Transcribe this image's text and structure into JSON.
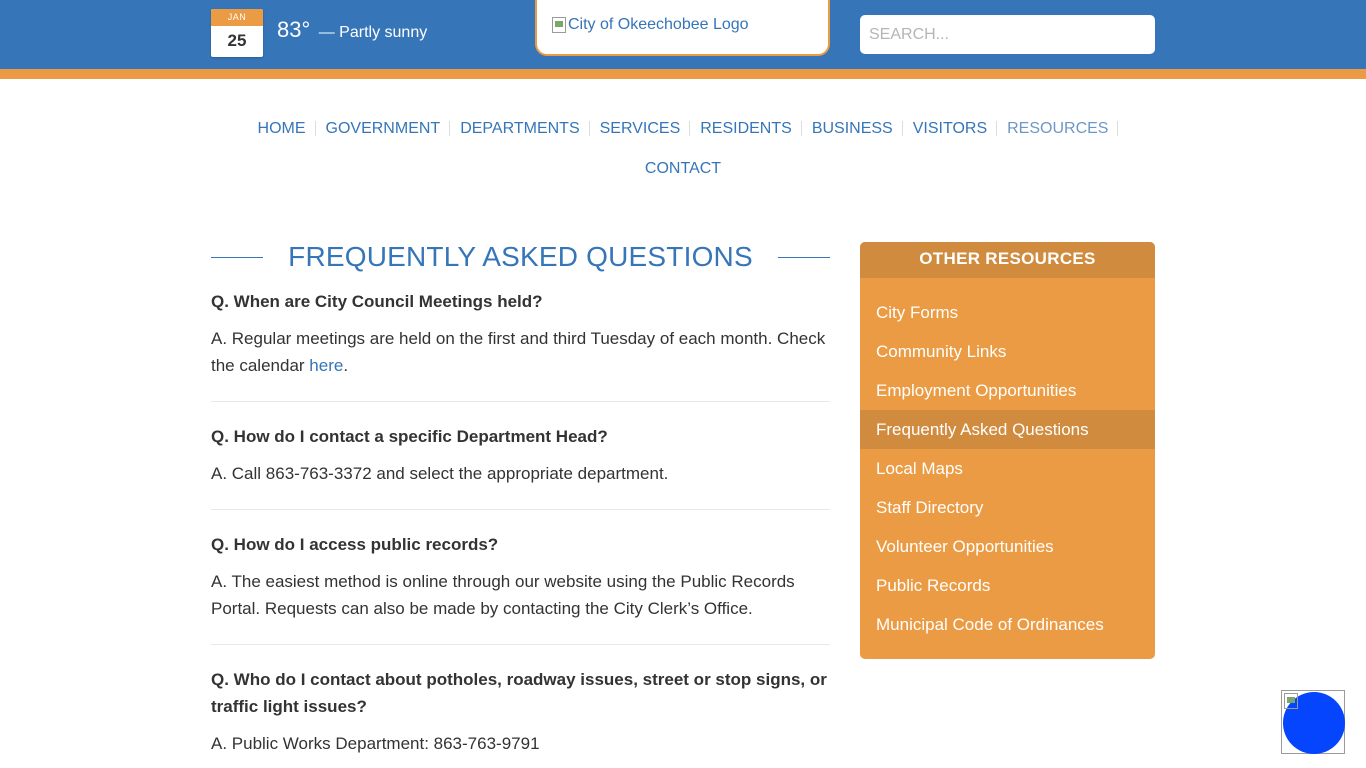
{
  "header": {
    "date": {
      "month": "JAN",
      "day": "25"
    },
    "weather": {
      "temp": "83°",
      "condition": "— Partly sunny"
    },
    "logo_alt": "City of Okeechobee Logo",
    "search_placeholder": "SEARCH..."
  },
  "nav": {
    "row1": [
      "HOME",
      "GOVERNMENT",
      "DEPARTMENTS",
      "SERVICES",
      "RESIDENTS",
      "BUSINESS",
      "VISITORS",
      "RESOURCES"
    ],
    "row2": [
      "CONTACT"
    ],
    "active": "RESOURCES"
  },
  "main": {
    "title": "FREQUENTLY ASKED QUESTIONS",
    "faqs": [
      {
        "q": "Q. When are City Council Meetings held?",
        "a_pre": "A. Regular meetings are held on the first and third Tuesday of each month. Check the calendar ",
        "a_link": "here",
        "a_post": "."
      },
      {
        "q": "Q. How do I contact a specific Department Head?",
        "a": "A. Call 863-763-3372 and select the appropriate department."
      },
      {
        "q": "Q. How do I access public records?",
        "a": "A. The easiest method is online through our website using the Public Records Portal. Requests can also be made by contacting the City Clerk’s Office."
      },
      {
        "q": "Q. Who do I contact about potholes, roadway issues, street or stop signs, or traffic light issues?",
        "a": "A. Public Works Department: 863-763-9791"
      }
    ]
  },
  "sidebar": {
    "title": "OTHER RESOURCES",
    "items": [
      "City Forms",
      "Community Links",
      "Employment Opportunities",
      "Frequently Asked Questions",
      "Local Maps",
      "Staff Directory",
      "Volunteer Opportunities",
      "Public Records",
      "Municipal Code of Ordinances"
    ],
    "current_index": 3
  },
  "colors": {
    "primary_blue": "#3575b8",
    "accent_orange": "#eb9b43",
    "orange_dark": "#d08b3e",
    "widget_blue": "#0545fd"
  }
}
